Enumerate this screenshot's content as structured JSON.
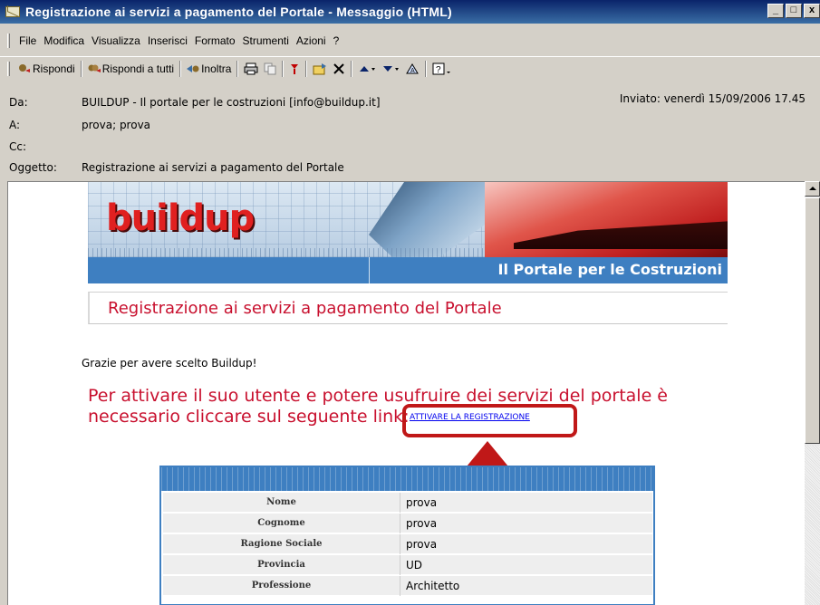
{
  "window": {
    "title": "Registrazione ai servizi a pagamento del Portale - Messaggio (HTML)",
    "buttons": [
      "_",
      "□",
      "x"
    ]
  },
  "menu": [
    "File",
    "Modifica",
    "Visualizza",
    "Inserisci",
    "Formato",
    "Strumenti",
    "Azioni",
    "?"
  ],
  "toolbar": {
    "reply": "Rispondi",
    "reply_all": "Rispondi a tutti",
    "forward": "Inoltra"
  },
  "header": {
    "from_label": "Da:",
    "from_value": "BUILDUP - Il portale per le costruzioni [info@buildup.it]",
    "to_label": "A:",
    "to_value": "prova; prova",
    "cc_label": "Cc:",
    "cc_value": "",
    "subject_label": "Oggetto:",
    "subject_value": "Registrazione ai servizi a pagamento del Portale",
    "sent": "Inviato: venerdì 15/09/2006 17.45"
  },
  "email": {
    "logo": "buildup",
    "portal_tagline": "Il Portale per le Costruzioni",
    "page_title": "Registrazione ai servizi a pagamento del Portale",
    "thanks": "Grazie per avere scelto Buildup!",
    "cta": "Per attivare il suo utente e potere usufruire dei servizi del portale è necessario cliccare sul seguente link:",
    "link": "ATTIVARE LA REGISTRAZIONE",
    "highlight_color": "#c01818",
    "rows": [
      {
        "key": "Nome",
        "value": "prova"
      },
      {
        "key": "Cognome",
        "value": "prova"
      },
      {
        "key": "Ragione Sociale",
        "value": "prova"
      },
      {
        "key": "Provincia",
        "value": "UD"
      },
      {
        "key": "Professione",
        "value": "Architetto"
      }
    ]
  }
}
